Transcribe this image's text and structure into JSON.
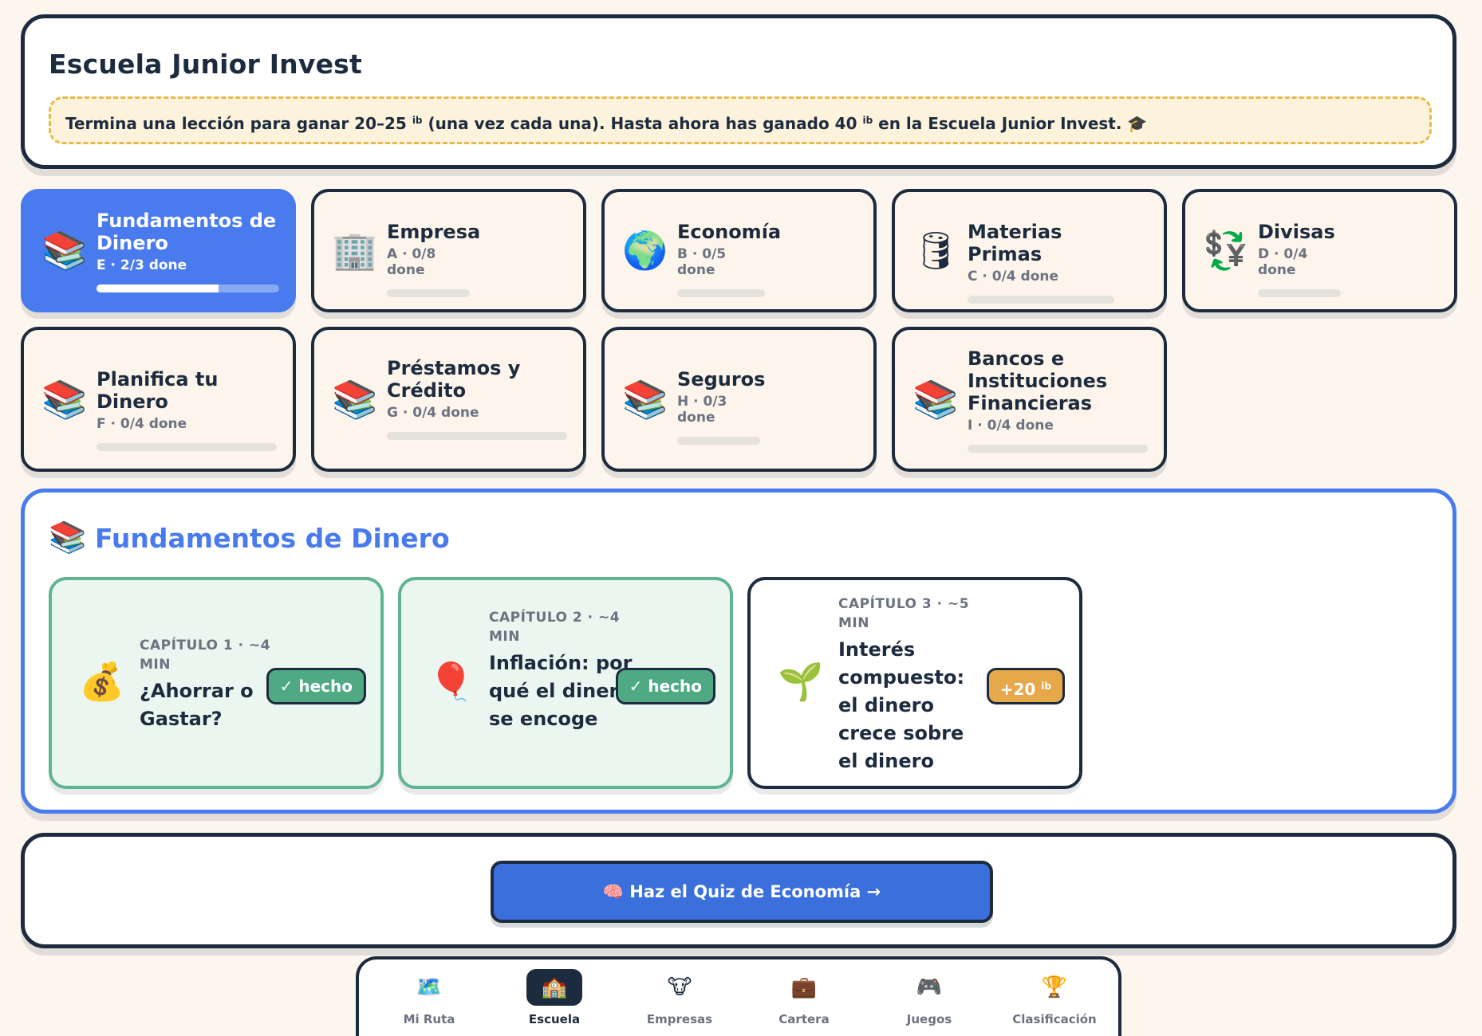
{
  "header": {
    "title": "Escuela Junior Invest",
    "notice_a": "Termina una lección para ganar 20–25 ",
    "notice_b": " (una vez cada una). Hasta ahora has ganado 40 ",
    "notice_c": " en la Escuela Junior Invest. 🎓",
    "coin_symbol": "ib"
  },
  "modules": [
    {
      "icon": "📚",
      "name": "Fundamentos de Dinero",
      "meta": "E · 2/3 done",
      "progress": 0.667,
      "active": true
    },
    {
      "icon": "🏢",
      "name": "Empresa",
      "meta": "A · 0/8 done",
      "progress": 0
    },
    {
      "icon": "🌍",
      "name": "Economía",
      "meta": "B · 0/5 done",
      "progress": 0
    },
    {
      "icon": "🛢",
      "name": "Materias Primas",
      "meta": "C · 0/4 done",
      "progress": 0
    },
    {
      "icon": "💱",
      "name": "Divisas",
      "meta": "D · 0/4 done",
      "progress": 0
    },
    {
      "icon": "📚",
      "name": "Planifica tu Dinero",
      "meta": "F · 0/4 done",
      "progress": 0
    },
    {
      "icon": "📚",
      "name": "Préstamos y Crédito",
      "meta": "G · 0/4 done",
      "progress": 0
    },
    {
      "icon": "📚",
      "name": "Seguros",
      "meta": "H · 0/3 done",
      "progress": 0
    },
    {
      "icon": "📚",
      "name": "Bancos e Instituciones Financieras",
      "meta": "I · 0/4 done",
      "progress": 0
    }
  ],
  "lessons_panel": {
    "icon": "📚",
    "title": "Fundamentos de Dinero",
    "lessons": [
      {
        "icon": "💰",
        "meta": "CAPÍTULO 1 · ~4 MIN",
        "title": "¿Ahorrar o Gastar?",
        "badge": "✓ hecho",
        "done": true
      },
      {
        "icon": "🎈",
        "meta": "CAPÍTULO 2 · ~4 MIN",
        "title": "Inflación: por qué el dinero se encoge",
        "badge": "✓ hecho",
        "done": true
      },
      {
        "icon": "🌱",
        "meta": "CAPÍTULO 3 · ~5 MIN",
        "title": "Interés compuesto: el dinero crece sobre el dinero",
        "badge": "+20",
        "badge_coin": "ib",
        "done": false
      }
    ]
  },
  "quiz": {
    "label": "🧠 Haz el Quiz de Economía →"
  },
  "nav": [
    {
      "icon": "🗺️",
      "label": "Mi Ruta"
    },
    {
      "icon": "🏫",
      "label": "Escuela",
      "active": true
    },
    {
      "icon": "🐮",
      "label": "Empresas"
    },
    {
      "icon": "💼",
      "label": "Cartera"
    },
    {
      "icon": "🎮",
      "label": "Juegos"
    },
    {
      "icon": "🏆",
      "label": "Clasificación"
    }
  ],
  "colors": {
    "accent": "#4a7bee",
    "navy": "#1c2b3e",
    "done_green": "#4faa84",
    "coin_gold": "#e6a84b",
    "background": "#fdf6ee"
  }
}
